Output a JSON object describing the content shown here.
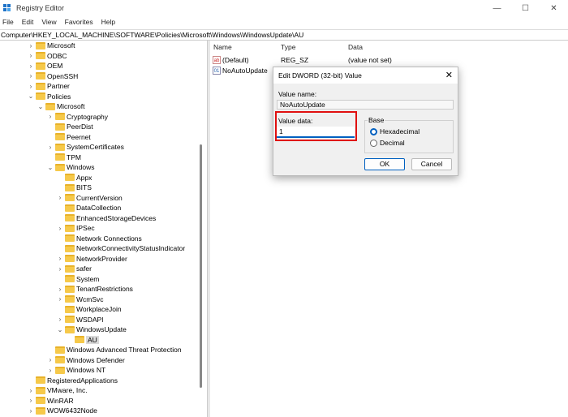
{
  "window": {
    "title": "Registry Editor",
    "minimize": "—",
    "maximize": "☐",
    "close": "✕"
  },
  "menu": [
    "File",
    "Edit",
    "View",
    "Favorites",
    "Help"
  ],
  "address": "Computer\\HKEY_LOCAL_MACHINE\\SOFTWARE\\Policies\\Microsoft\\Windows\\WindowsUpdate\\AU",
  "tree": [
    {
      "label": "Microsoft",
      "level": 0,
      "state": "collapsed"
    },
    {
      "label": "ODBC",
      "level": 0,
      "state": "collapsed"
    },
    {
      "label": "OEM",
      "level": 0,
      "state": "collapsed"
    },
    {
      "label": "OpenSSH",
      "level": 0,
      "state": "collapsed"
    },
    {
      "label": "Partner",
      "level": 0,
      "state": "collapsed"
    },
    {
      "label": "Policies",
      "level": 0,
      "state": "expanded"
    },
    {
      "label": "Microsoft",
      "level": 1,
      "state": "expanded"
    },
    {
      "label": "Cryptography",
      "level": 2,
      "state": "collapsed"
    },
    {
      "label": "PeerDist",
      "level": 2,
      "state": "leaf"
    },
    {
      "label": "Peernet",
      "level": 2,
      "state": "leaf"
    },
    {
      "label": "SystemCertificates",
      "level": 2,
      "state": "collapsed"
    },
    {
      "label": "TPM",
      "level": 2,
      "state": "leaf"
    },
    {
      "label": "Windows",
      "level": 2,
      "state": "expanded"
    },
    {
      "label": "Appx",
      "level": 3,
      "state": "leaf"
    },
    {
      "label": "BITS",
      "level": 3,
      "state": "leaf"
    },
    {
      "label": "CurrentVersion",
      "level": 3,
      "state": "collapsed"
    },
    {
      "label": "DataCollection",
      "level": 3,
      "state": "leaf"
    },
    {
      "label": "EnhancedStorageDevices",
      "level": 3,
      "state": "leaf"
    },
    {
      "label": "IPSec",
      "level": 3,
      "state": "collapsed"
    },
    {
      "label": "Network Connections",
      "level": 3,
      "state": "leaf"
    },
    {
      "label": "NetworkConnectivityStatusIndicator",
      "level": 3,
      "state": "leaf"
    },
    {
      "label": "NetworkProvider",
      "level": 3,
      "state": "collapsed"
    },
    {
      "label": "safer",
      "level": 3,
      "state": "collapsed"
    },
    {
      "label": "System",
      "level": 3,
      "state": "leaf"
    },
    {
      "label": "TenantRestrictions",
      "level": 3,
      "state": "collapsed"
    },
    {
      "label": "WcmSvc",
      "level": 3,
      "state": "collapsed"
    },
    {
      "label": "WorkplaceJoin",
      "level": 3,
      "state": "leaf"
    },
    {
      "label": "WSDAPI",
      "level": 3,
      "state": "collapsed"
    },
    {
      "label": "WindowsUpdate",
      "level": 3,
      "state": "expanded"
    },
    {
      "label": "AU",
      "level": 4,
      "state": "leaf",
      "selected": true
    },
    {
      "label": "Windows Advanced Threat Protection",
      "level": 2,
      "state": "leaf"
    },
    {
      "label": "Windows Defender",
      "level": 2,
      "state": "collapsed"
    },
    {
      "label": "Windows NT",
      "level": 2,
      "state": "collapsed"
    },
    {
      "label": "RegisteredApplications",
      "level": 0,
      "state": "leaf"
    },
    {
      "label": "VMware, Inc.",
      "level": 0,
      "state": "collapsed"
    },
    {
      "label": "WinRAR",
      "level": 0,
      "state": "collapsed"
    },
    {
      "label": "WOW6432Node",
      "level": 0,
      "state": "collapsed"
    }
  ],
  "list": {
    "columns": [
      "Name",
      "Type",
      "Data"
    ],
    "rows": [
      {
        "icon": "string-value-icon",
        "glyph": "ab",
        "name": "(Default)",
        "type": "REG_SZ",
        "data": "(value not set)"
      },
      {
        "icon": "dword-value-icon",
        "glyph": "01",
        "name": "NoAutoUpdate",
        "type": "",
        "data": ""
      }
    ]
  },
  "dialog": {
    "title": "Edit DWORD (32-bit) Value",
    "close": "✕",
    "value_name_label": "Value name:",
    "value_name": "NoAutoUpdate",
    "value_data_label": "Value data:",
    "value_data": "1",
    "base_label": "Base",
    "hex_label": "Hexadecimal",
    "dec_label": "Decimal",
    "selected_base": "Hexadecimal",
    "ok": "OK",
    "cancel": "Cancel",
    "highlight_color": "#e01010"
  }
}
